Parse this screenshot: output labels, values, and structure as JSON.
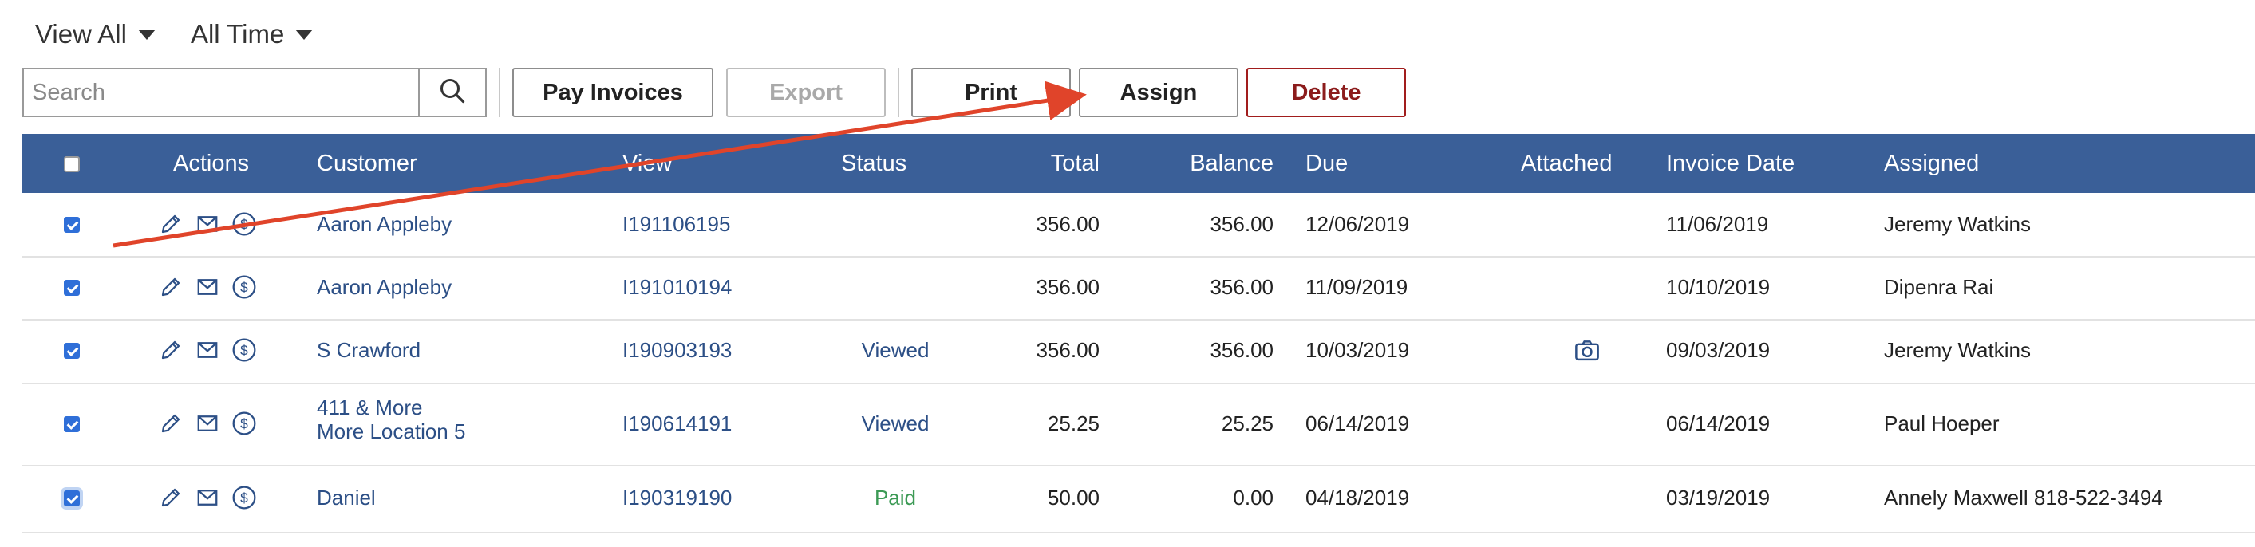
{
  "filters": {
    "view": "View All",
    "time": "All Time"
  },
  "search": {
    "placeholder": "Search"
  },
  "toolbar": {
    "pay_invoices": "Pay Invoices",
    "export": "Export",
    "print": "Print",
    "assign": "Assign",
    "delete": "Delete"
  },
  "columns": {
    "actions": "Actions",
    "customer": "Customer",
    "view": "View",
    "status": "Status",
    "total": "Total",
    "balance": "Balance",
    "due": "Due",
    "attached": "Attached",
    "invoice_date": "Invoice Date",
    "assigned": "Assigned"
  },
  "rows": [
    {
      "customer": "Aaron Appleby",
      "customer2": "",
      "view": "I191106195",
      "status": "",
      "total": "356.00",
      "balance": "356.00",
      "due": "12/06/2019",
      "attached": false,
      "invoice_date": "11/06/2019",
      "assigned": "Jeremy Watkins",
      "checked": true
    },
    {
      "customer": "Aaron Appleby",
      "customer2": "",
      "view": "I191010194",
      "status": "",
      "total": "356.00",
      "balance": "356.00",
      "due": "11/09/2019",
      "attached": false,
      "invoice_date": "10/10/2019",
      "assigned": "Dipenra Rai",
      "checked": true
    },
    {
      "customer": "S Crawford",
      "customer2": "",
      "view": "I190903193",
      "status": "Viewed",
      "total": "356.00",
      "balance": "356.00",
      "due": "10/03/2019",
      "attached": true,
      "invoice_date": "09/03/2019",
      "assigned": "Jeremy Watkins",
      "checked": true
    },
    {
      "customer": "411 & More",
      "customer2": "More Location 5",
      "view": "I190614191",
      "status": "Viewed",
      "total": "25.25",
      "balance": "25.25",
      "due": "06/14/2019",
      "attached": false,
      "invoice_date": "06/14/2019",
      "assigned": "Paul Hoeper",
      "checked": true
    },
    {
      "customer": "Daniel",
      "customer2": "",
      "view": "I190319190",
      "status": "Paid",
      "total": "50.00",
      "balance": "0.00",
      "due": "04/18/2019",
      "attached": false,
      "invoice_date": "03/19/2019",
      "assigned": "Annely Maxwell 818-522-3494",
      "checked": true
    }
  ],
  "icons": {
    "row_actions": [
      "pencil-icon",
      "envelope-icon",
      "dollar-circle-icon"
    ],
    "attachment": "camera-icon",
    "search": "search-icon"
  },
  "colors": {
    "header_bg": "#3a5f98",
    "link": "#2c4f86",
    "paid": "#3c9a55",
    "delete": "#a11d1d",
    "annotation_arrow": "#e0442a",
    "checkbox": "#2f6fd8"
  }
}
